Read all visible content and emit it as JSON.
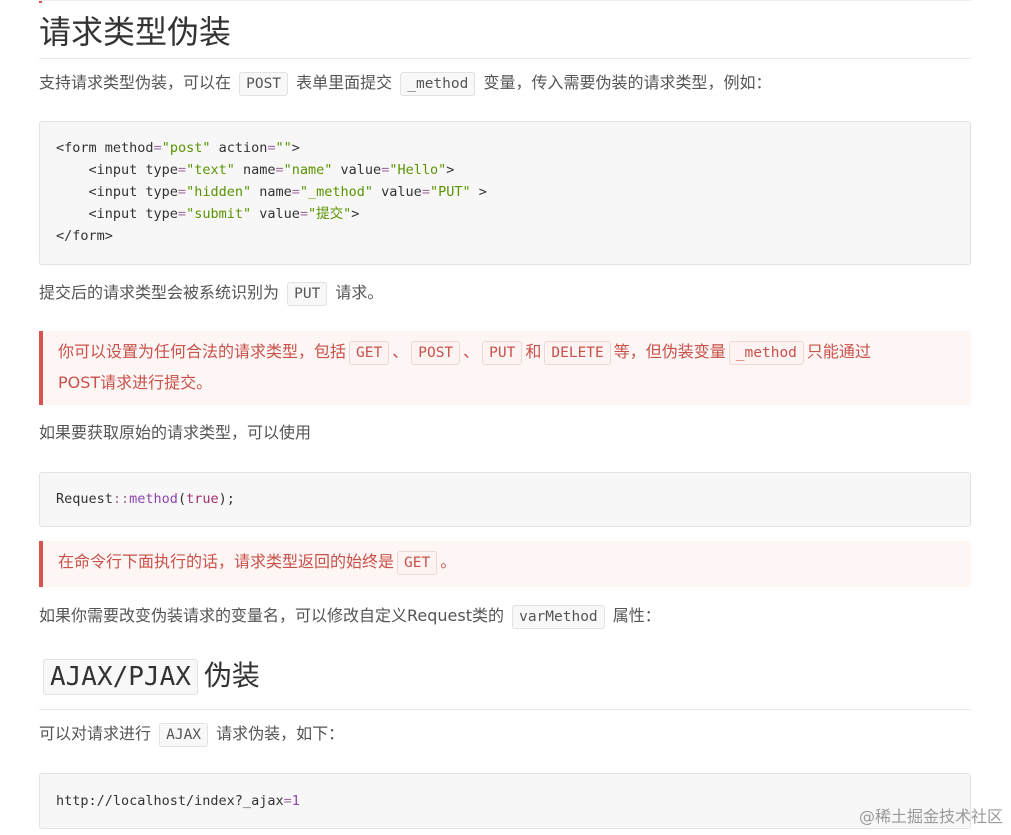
{
  "section1": {
    "title": "请求类型伪装",
    "intro": {
      "t1": "支持请求类型伪装，可以在",
      "c1": "POST",
      "t2": "表单里面提交",
      "c2": "_method",
      "t3": "变量，传入需要伪装的请求类型，例如："
    },
    "form_code": {
      "l1_open": "<form ",
      "l1_attr1": "method",
      "l1_val1": "\"post\"",
      "l1_attr2": " action",
      "l1_val2": "\"\"",
      "l1_close": ">",
      "l2_open": "    <input ",
      "l2_attr1": "type",
      "l2_val1": "\"text\"",
      "l2_attr2": " name",
      "l2_val2": "\"name\"",
      "l2_attr3": " value",
      "l2_val3": "\"Hello\"",
      "l2_close": ">",
      "l3_open": "    <input ",
      "l3_attr1": "type",
      "l3_val1": "\"hidden\"",
      "l3_attr2": " name",
      "l3_val2": "\"_method\"",
      "l3_attr3": " value",
      "l3_val3": "\"PUT\"",
      "l3_close": " >",
      "l4_open": "    <input ",
      "l4_attr1": "type",
      "l4_val1": "\"submit\"",
      "l4_attr2": " value",
      "l4_val2": "\"提交\"",
      "l4_close": ">",
      "l5": "</form>",
      "eq": "="
    },
    "after": {
      "t1": "提交后的请求类型会被系统识别为",
      "c1": "PUT",
      "t2": "请求。"
    },
    "alert1": {
      "t1": "你可以设置为任何合法的请求类型，包括",
      "c1": "GET",
      "s1": "、",
      "c2": "POST",
      "s2": "、",
      "c3": "PUT",
      "t2": "和",
      "c4": "DELETE",
      "t3": "等，但伪装变量",
      "c5": "_method",
      "t4": "只能通过",
      "t5": "POST请求进行提交。"
    },
    "original": "如果要获取原始的请求类型，可以使用",
    "method_code": {
      "cls": "Request",
      "sep": "::",
      "fn": "method",
      "open": "(",
      "arg": "true",
      "close": ");"
    },
    "alert2": {
      "t1": "在命令行下面执行的话，请求类型返回的始终是",
      "c1": "GET",
      "t2": "。"
    },
    "varname": {
      "t1": "如果你需要改变伪装请求的变量名，可以修改自定义Request类的",
      "c1": "varMethod",
      "t2": "属性："
    }
  },
  "section2": {
    "title_code": "AJAX/PJAX",
    "title_text": "伪装",
    "intro": {
      "t1": "可以对请求进行",
      "c1": "AJAX",
      "t2": "请求伪装，如下："
    },
    "url_code": {
      "base": "http://localhost/index?_ajax",
      "eq": "=",
      "val": "1"
    }
  },
  "watermark": "@稀土掘金技术社区"
}
